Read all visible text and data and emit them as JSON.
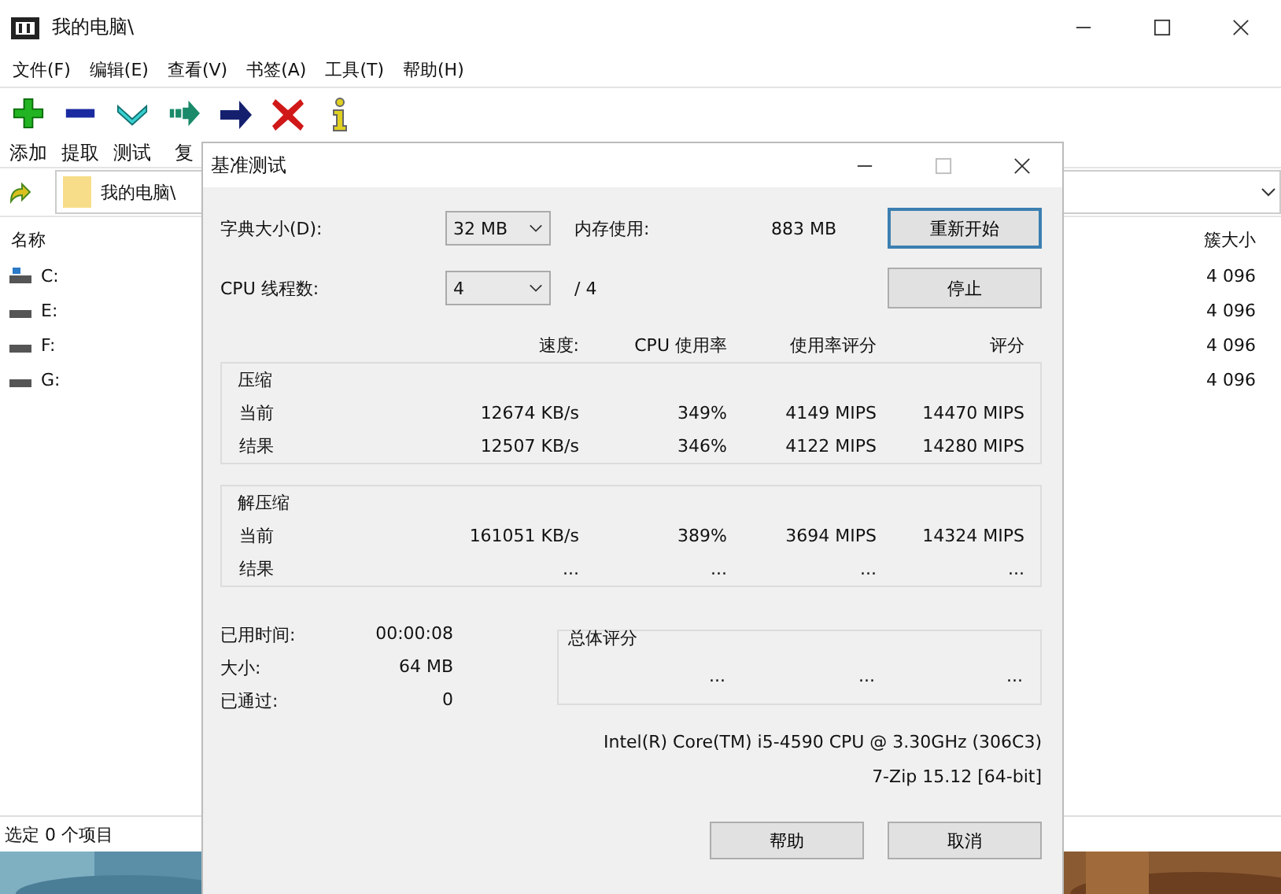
{
  "main_window": {
    "title": "我的电脑\\",
    "menu": [
      "文件(F)",
      "编辑(E)",
      "查看(V)",
      "书签(A)",
      "工具(T)",
      "帮助(H)"
    ],
    "toolbar": [
      {
        "kind": "add",
        "label": "添加"
      },
      {
        "kind": "extract",
        "label": "提取"
      },
      {
        "kind": "test",
        "label": "测试"
      },
      {
        "kind": "copy",
        "label": "复"
      },
      {
        "kind": "move"
      },
      {
        "kind": "delete"
      },
      {
        "kind": "info"
      }
    ],
    "address": "我的电脑\\",
    "columns": [
      "名称",
      "簇大小"
    ],
    "drives": [
      {
        "kind": "system",
        "name": "C:",
        "cluster_size": "4 096"
      },
      {
        "kind": "local",
        "name": "E:",
        "cluster_size": "4 096"
      },
      {
        "kind": "local",
        "name": "F:",
        "cluster_size": "4 096"
      },
      {
        "kind": "local",
        "name": "G:",
        "cluster_size": "4 096"
      }
    ],
    "status_bar": "选定 0 个项目"
  },
  "dialog": {
    "title": "基准测试",
    "dictionary_label": "字典大小(D):",
    "dictionary_value": "32 MB",
    "memory_label": "内存使用:",
    "memory_value": "883 MB",
    "threads_label": "CPU 线程数:",
    "threads_value": "4",
    "threads_total": "/ 4",
    "side_buttons": [
      {
        "label": "重新开始",
        "default": true
      },
      {
        "label": "停止",
        "default": false
      }
    ],
    "headers": [
      "速度:",
      "CPU 使用率",
      "使用率评分",
      "评分"
    ],
    "groups": [
      {
        "title": "压缩",
        "rows": [
          {
            "label": "当前",
            "values": [
              "12674 KB/s",
              "349%",
              "4149 MIPS",
              "14470 MIPS"
            ]
          },
          {
            "label": "结果",
            "values": [
              "12507 KB/s",
              "346%",
              "4122 MIPS",
              "14280 MIPS"
            ]
          }
        ]
      },
      {
        "title": "解压缩",
        "rows": [
          {
            "label": "当前",
            "values": [
              "161051 KB/s",
              "389%",
              "3694 MIPS",
              "14324 MIPS"
            ]
          },
          {
            "label": "结果",
            "values": [
              "...",
              "...",
              "...",
              "..."
            ]
          }
        ]
      }
    ],
    "stats": [
      {
        "label": "已用时间:",
        "value": "00:00:08"
      },
      {
        "label": "大小:",
        "value": "64 MB"
      },
      {
        "label": "已通过:",
        "value": "0"
      }
    ],
    "total": {
      "title": "总体评分",
      "values": [
        "...",
        "...",
        "..."
      ]
    },
    "cpu": "Intel(R) Core(TM) i5-4590 CPU @ 3.30GHz (306C3)",
    "version": "7-Zip 15.12 [64-bit]",
    "buttons": [
      {
        "label": "帮助",
        "default": false
      },
      {
        "label": "取消",
        "default": false
      }
    ]
  }
}
